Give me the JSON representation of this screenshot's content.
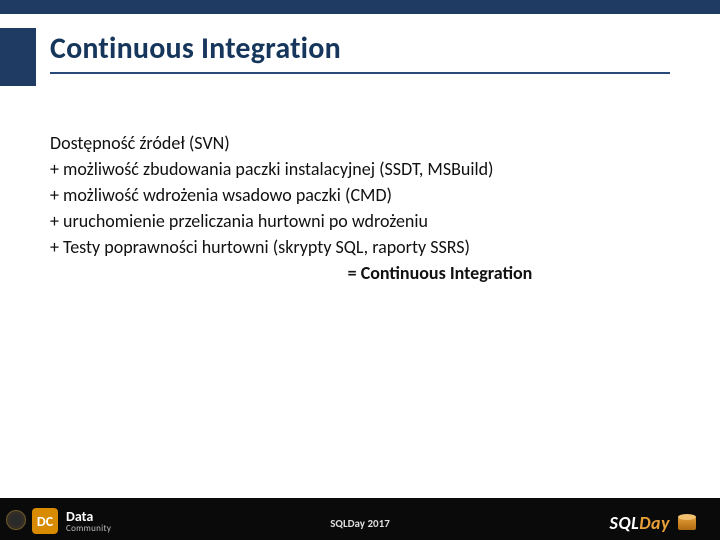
{
  "title": "Continuous Integration",
  "body": {
    "l1": "Dostępność źródeł (SVN)",
    "l2": "+ możliwość zbudowania paczki instalacyjnej (SSDT, MSBuild)",
    "l3": "+ możliwość wdrożenia wsadowo paczki (CMD)",
    "l4": "+ uruchomienie przeliczania hurtowni po wdrożeniu",
    "l5": "+ Testy poprawności hurtowni (skrypty SQL, raporty SSRS)",
    "result": "= Continuous Integration"
  },
  "footer": {
    "center": "SQLDay 2017",
    "dc_badge": "DC",
    "dc_line1": "Data",
    "dc_line2": "Community",
    "sql_part1": "SQL",
    "sql_part2": "Day"
  }
}
